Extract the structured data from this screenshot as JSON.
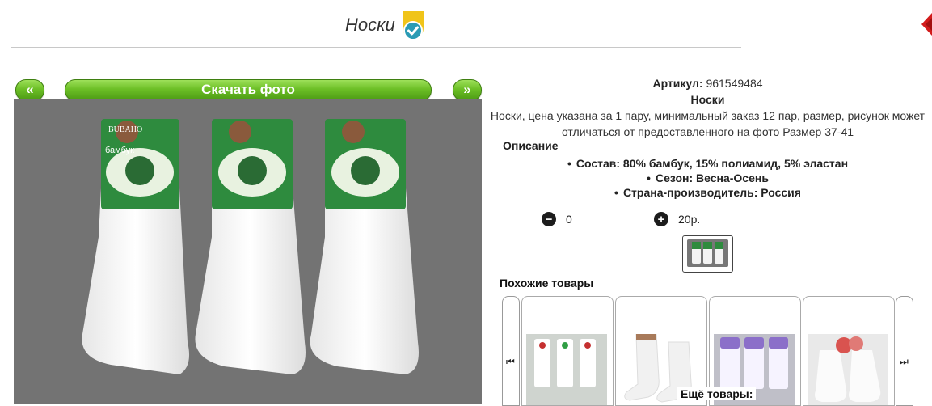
{
  "header": {
    "title": "Носки",
    "verified_icon": "verified-shield-icon"
  },
  "gallery": {
    "prev_label": "«",
    "next_label": "»",
    "download_label": "Скачать фото"
  },
  "product": {
    "article_label": "Артикул:",
    "article_value": "961549484",
    "name": "Носки",
    "summary_line1": "Носки, цена указана за 1 пару, минимальный заказ 12 пар, размер, рисунок может",
    "summary_line2": "отличаться от предоставленного на фото Размер 37-41",
    "description_title": "Описание",
    "description_items": [
      "Состав: 80% бамбук, 15% полиамид, 5% эластан",
      "Сезон: Весна-Осень",
      "Страна-производитель: Россия"
    ],
    "quantity": "0",
    "price": "20р."
  },
  "photo_labels": {
    "brand": "BUBAHO",
    "subtitle": "бамбук"
  },
  "similar": {
    "title": "Похожие товары",
    "more_title": "Ещё товары:"
  },
  "colors": {
    "accent_green": "#6cbf26",
    "photo_bg": "#737373"
  }
}
